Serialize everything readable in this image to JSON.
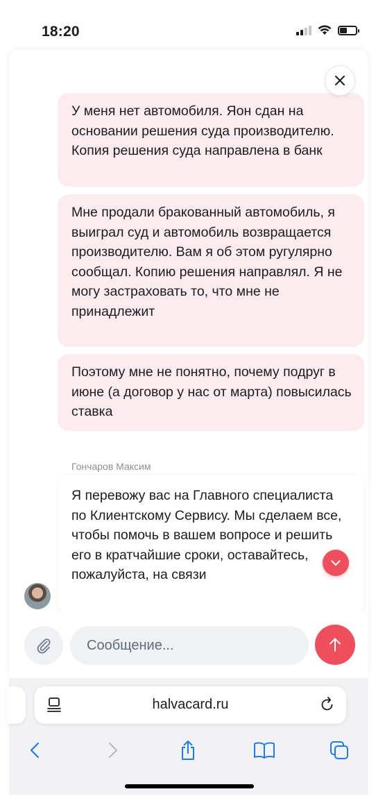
{
  "status": {
    "time": "18:20"
  },
  "chat": {
    "messages": [
      {
        "text": "У меня нет автомобиля. Яон сдан на основании решения суда производителю. Копия решения суда направлена в банк"
      },
      {
        "text": "Мне продали бракованный автомобиль, я выиграл суд и автомобиль возвращается производителю. Вам я об этом ругулярно сообщал. Копию решения направлял. Я не могу застраховать то, что мне не принадлежит"
      },
      {
        "text": "Поэтому мне не понятно, почему подруг в июне (а договор у нас от марта) повысилась ставка"
      }
    ],
    "agent": {
      "name": "Гончаров Максим",
      "text": "Я перевожу вас на Главного специалиста по Клиентскому Сервису. Мы сделаем все, чтобы помочь в вашем вопросе и решить его в кратчайшие сроки, оставайтесь, пожалуйста, на связи"
    }
  },
  "composer": {
    "placeholder": "Сообщение..."
  },
  "browser": {
    "url": "halvacard.ru"
  },
  "colors": {
    "accent": "#ef4f5c",
    "bubble": "#fdecef",
    "safari_blue": "#1a7cf5"
  }
}
